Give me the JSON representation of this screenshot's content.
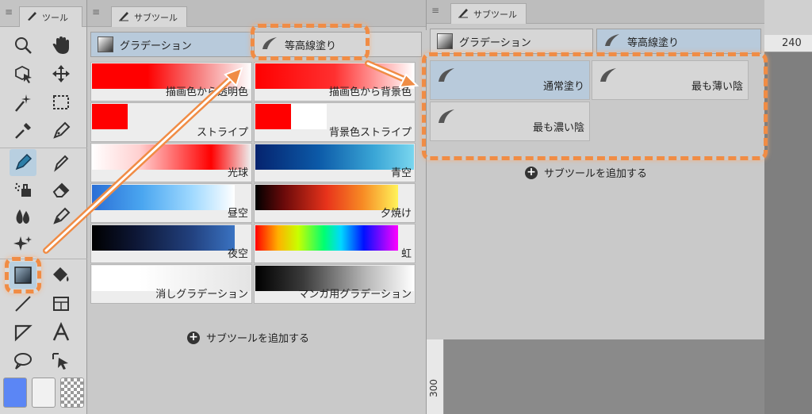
{
  "tool_panel": {
    "tab_label": "ツール",
    "colors": {
      "main": "#5b86f5",
      "sub": "#f1f1f1"
    }
  },
  "subtool_panel": {
    "tab_label": "サブツール",
    "group_tabs": [
      "グラデーション",
      "等高線塗り"
    ],
    "gradients": [
      {
        "label": "描画色から透明色",
        "css": "linear-gradient(90deg,#ff0000 0%,#ff0000 35%,rgba(255,0,0,0.5) 65%,rgba(255,255,255,0.9) 100%)"
      },
      {
        "label": "描画色から背景色",
        "css": "linear-gradient(90deg,#ff0000 0%,#ff3030 50%,#ffffff 100%)"
      },
      {
        "label": "ストライプ",
        "css": "linear-gradient(90deg,#ff0000 0%,#ff0000 50%,#ededed 50%,#ededed 100%)"
      },
      {
        "label": "背景色ストライプ",
        "css": "linear-gradient(90deg,#ff0000 0%,#ff0000 50%,#ffffff 50%,#ffffff 100%)"
      },
      {
        "label": "光球",
        "css": "linear-gradient(90deg,#ffffff 0%,#ffd0d0 30%,#ff3030 65%,#ff0000 75%,#ededed 100%)"
      },
      {
        "label": "青空",
        "css": "linear-gradient(90deg,#05236e 0%,#0c5aa8 40%,#3aa6d6 75%,#7ad6ef 100%)"
      },
      {
        "label": "昼空",
        "css": "linear-gradient(90deg,#2b6fd6 0%,#4aa6f0 35%,#9fd9ff 70%,#ffffff 100%)"
      },
      {
        "label": "夕焼け",
        "css": "linear-gradient(90deg,#000000 0%,#6a0a0a 20%,#e8331b 50%,#f78a24 75%,#fff35a 100%)"
      },
      {
        "label": "夜空",
        "css": "linear-gradient(90deg,#000000 0%,#0d1634 30%,#22417f 70%,#3a73c2 100%)"
      },
      {
        "label": "虹",
        "css": "linear-gradient(90deg,#ff0000 0%,#ffb000 16%,#c8ff00 30%,#00ff70 48%,#00d8ff 60%,#0010ff 76%,#ff00ff 100%)"
      },
      {
        "label": "消しグラデーション",
        "css": "linear-gradient(90deg,#ffffff 0%,#ffffff 30%,#e4e4e4 100%)"
      },
      {
        "label": "マンガ用グラデーション",
        "css": "linear-gradient(90deg,#000000 0%,#3a3a3a 30%,#b8b8b8 70%,#ffffff 100%)"
      }
    ],
    "add_label": "サブツールを追加する"
  },
  "subtool_panel_2": {
    "tab_label": "サブツール",
    "group_tabs": [
      "グラデーション",
      "等高線塗り"
    ],
    "items": [
      "通常塗り",
      "最も薄い陰",
      "最も濃い陰"
    ],
    "add_label": "サブツールを追加する"
  },
  "rulers": {
    "top": "240",
    "left": "300"
  }
}
